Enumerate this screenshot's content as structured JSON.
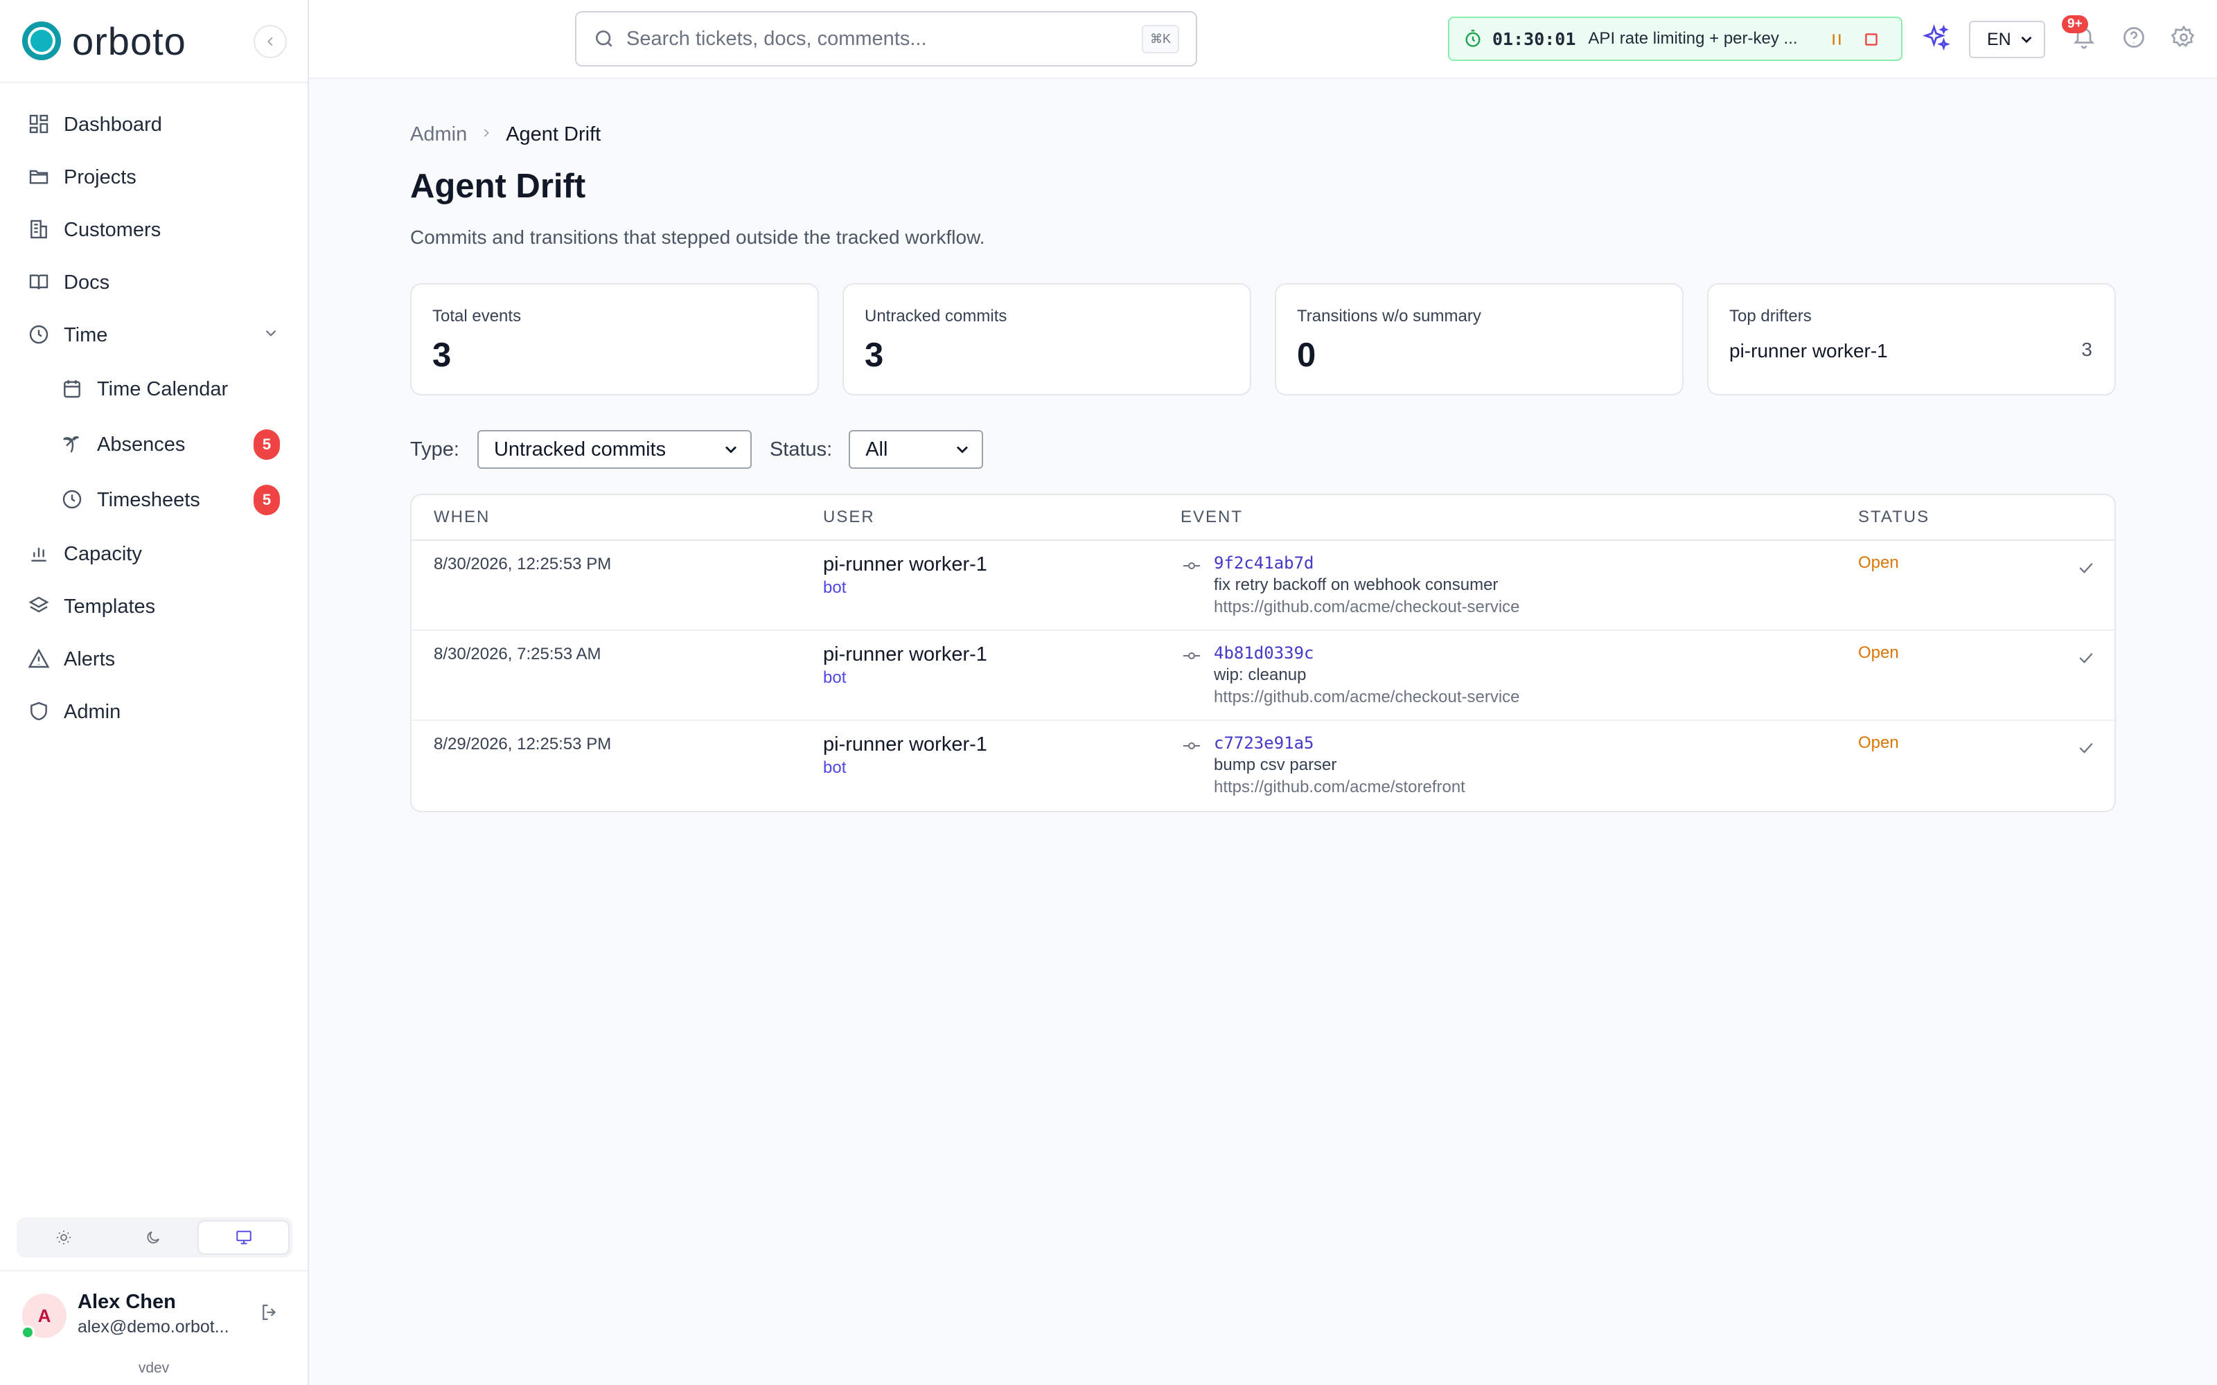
{
  "sidebar": {
    "brand": "orboto",
    "items": [
      {
        "label": "Dashboard"
      },
      {
        "label": "Projects"
      },
      {
        "label": "Customers"
      },
      {
        "label": "Docs"
      },
      {
        "label": "Time"
      },
      {
        "label": "Time Calendar"
      },
      {
        "label": "Absences",
        "badge": "5"
      },
      {
        "label": "Timesheets",
        "badge": "5"
      },
      {
        "label": "Capacity"
      },
      {
        "label": "Templates"
      },
      {
        "label": "Alerts"
      },
      {
        "label": "Admin"
      }
    ],
    "user": {
      "initial": "A",
      "name": "Alex Chen",
      "email": "alex@demo.orbot..."
    },
    "version": "vdev"
  },
  "topbar": {
    "search_placeholder": "Search tickets, docs, comments...",
    "search_shortcut": "⌘K",
    "timer": {
      "time": "01:30:01",
      "task": "API rate limiting + per-key ..."
    },
    "language": "EN",
    "notifications": "9+"
  },
  "page": {
    "breadcrumb": [
      "Admin",
      "Agent Drift"
    ],
    "title": "Agent Drift",
    "subtitle": "Commits and transitions that stepped outside the tracked workflow."
  },
  "stats": {
    "total_events": {
      "label": "Total events",
      "value": "3"
    },
    "untracked_commits": {
      "label": "Untracked commits",
      "value": "3"
    },
    "transitions": {
      "label": "Transitions w/o summary",
      "value": "0"
    },
    "top_drifters": {
      "label": "Top drifters",
      "name": "pi-runner worker-1",
      "count": "3"
    }
  },
  "filters": {
    "type_label": "Type:",
    "type_value": "Untracked commits",
    "status_label": "Status:",
    "status_value": "All"
  },
  "table": {
    "headers": {
      "when": "WHEN",
      "user": "USER",
      "event": "EVENT",
      "status": "STATUS"
    },
    "rows": [
      {
        "when": "8/30/2026, 12:25:53 PM",
        "user": "pi-runner worker-1",
        "role": "bot",
        "sha": "9f2c41ab7d",
        "message": "fix retry backoff on webhook consumer",
        "repo": "https://github.com/acme/checkout-service",
        "status": "Open"
      },
      {
        "when": "8/30/2026, 7:25:53 AM",
        "user": "pi-runner worker-1",
        "role": "bot",
        "sha": "4b81d0339c",
        "message": "wip: cleanup",
        "repo": "https://github.com/acme/checkout-service",
        "status": "Open"
      },
      {
        "when": "8/29/2026, 12:25:53 PM",
        "user": "pi-runner worker-1",
        "role": "bot",
        "sha": "c7723e91a5",
        "message": "bump csv parser",
        "repo": "https://github.com/acme/storefront",
        "status": "Open"
      }
    ]
  }
}
